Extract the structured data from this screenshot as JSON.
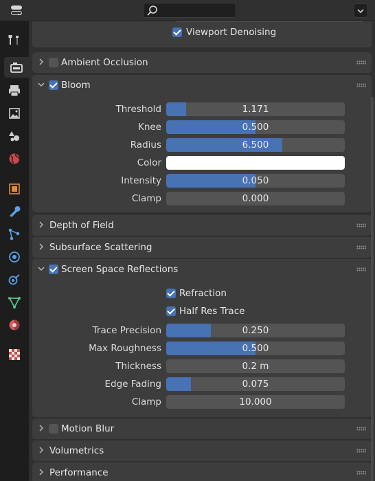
{
  "header": {
    "search_placeholder": ""
  },
  "tabs": [
    "tool",
    "render",
    "output",
    "view-layer",
    "scene",
    "world",
    "object",
    "modifiers",
    "particles",
    "physics",
    "constraints",
    "data",
    "material",
    "texture"
  ],
  "top": {
    "viewport_denoising": "Viewport Denoising",
    "viewport_denoising_checked": true
  },
  "ambient_occlusion": {
    "title": "Ambient Occlusion",
    "enabled": false
  },
  "bloom": {
    "title": "Bloom",
    "enabled": true,
    "threshold": {
      "label": "Threshold",
      "value": "1.171",
      "fraction": 0.11
    },
    "knee": {
      "label": "Knee",
      "value": "0.500",
      "fraction": 0.5
    },
    "radius": {
      "label": "Radius",
      "value": "6.500",
      "fraction": 0.65
    },
    "color": {
      "label": "Color",
      "value": "#ffffff"
    },
    "intensity": {
      "label": "Intensity",
      "value": "0.050",
      "fraction": 0.5
    },
    "clamp": {
      "label": "Clamp",
      "value": "0.000",
      "fraction": 0
    }
  },
  "depth_of_field": {
    "title": "Depth of Field"
  },
  "subsurface": {
    "title": "Subsurface Scattering"
  },
  "ssr": {
    "title": "Screen Space Reflections",
    "enabled": true,
    "refraction": {
      "label": "Refraction",
      "checked": true
    },
    "half_res": {
      "label": "Half Res Trace",
      "checked": true
    },
    "trace_precision": {
      "label": "Trace Precision",
      "value": "0.250",
      "fraction": 0.25
    },
    "max_roughness": {
      "label": "Max Roughness",
      "value": "0.500",
      "fraction": 0.5
    },
    "thickness": {
      "label": "Thickness",
      "value": "0.2 m",
      "fraction": 0
    },
    "edge_fading": {
      "label": "Edge Fading",
      "value": "0.075",
      "fraction": 0.14
    },
    "clamp": {
      "label": "Clamp",
      "value": "10.000",
      "fraction": 0
    }
  },
  "motion_blur": {
    "title": "Motion Blur",
    "enabled": false
  },
  "volumetrics": {
    "title": "Volumetrics"
  },
  "performance": {
    "title": "Performance"
  }
}
